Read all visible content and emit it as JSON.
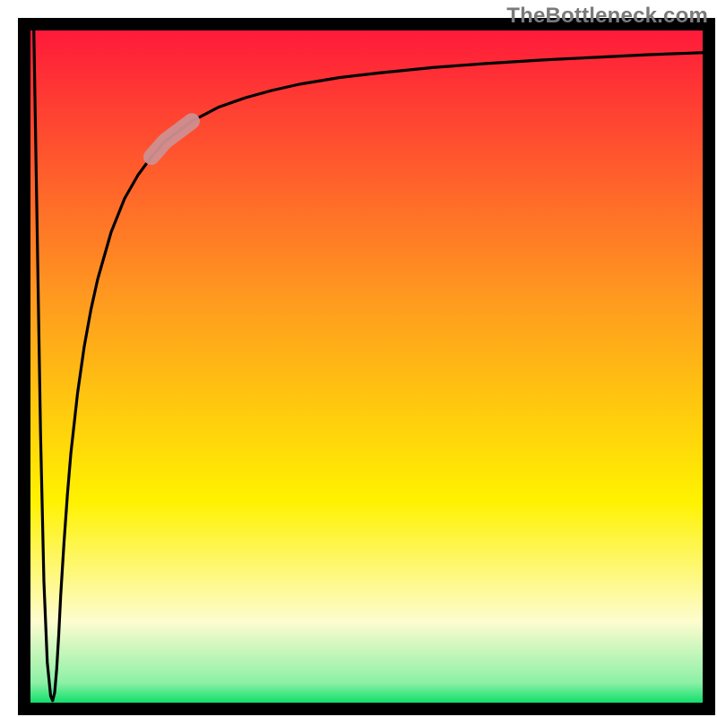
{
  "watermark": {
    "text": "TheBottleneck.com"
  },
  "chart_data": {
    "type": "line",
    "title": "",
    "xlabel": "",
    "ylabel": "",
    "xlim": [
      0,
      100
    ],
    "ylim": [
      0,
      100
    ],
    "grid": false,
    "legend": false,
    "background_gradient_stops": [
      {
        "offset": 0.0,
        "color": "#ff1a3a"
      },
      {
        "offset": 0.4,
        "color": "#ff9a1f"
      },
      {
        "offset": 0.7,
        "color": "#fff200"
      },
      {
        "offset": 0.88,
        "color": "#fdfccf"
      },
      {
        "offset": 0.97,
        "color": "#8df0a6"
      },
      {
        "offset": 1.0,
        "color": "#11e06a"
      }
    ],
    "curve_x": [
      0.5,
      1.0,
      1.5,
      2.0,
      2.5,
      3.0,
      3.3,
      3.6,
      3.9,
      4.2,
      4.5,
      5.0,
      5.5,
      6.0,
      7.0,
      8.0,
      9.0,
      10.0,
      12.0,
      14.0,
      16.0,
      18.0,
      20.0,
      24.0,
      28.0,
      32.0,
      36.0,
      40.0,
      46.0,
      52.0,
      60.0,
      68.0,
      76.0,
      84.0,
      92.0,
      100.0
    ],
    "curve_y": [
      100.0,
      70.0,
      40.0,
      18.0,
      6.0,
      1.0,
      0.3,
      1.5,
      5.0,
      10.0,
      16.0,
      24.0,
      31.0,
      37.0,
      46.0,
      53.0,
      58.5,
      63.0,
      70.0,
      75.0,
      78.5,
      81.2,
      83.5,
      86.5,
      88.6,
      90.0,
      91.1,
      92.0,
      93.0,
      93.7,
      94.5,
      95.1,
      95.6,
      96.0,
      96.4,
      96.7
    ],
    "highlight_segment": {
      "x0": 18.0,
      "x1": 24.0
    }
  }
}
